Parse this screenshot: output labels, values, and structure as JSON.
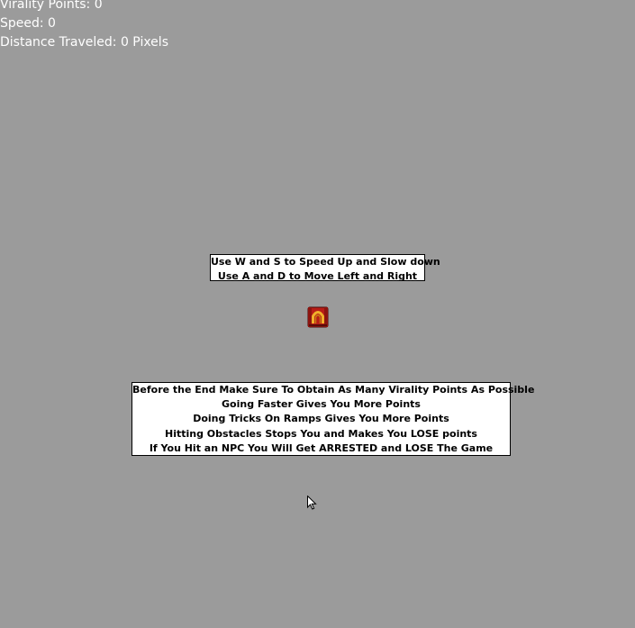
{
  "hud": {
    "virality": "Virality Points: 0",
    "speed": "Speed: 0",
    "distance": "Distance Traveled: 0 Pixels"
  },
  "controls": [
    "Use W and S to Speed Up and Slow down",
    "Use A and D to Move Left and Right"
  ],
  "rules": [
    "Before the End Make Sure To Obtain As Many Virality Points As Possible",
    "Going Faster Gives You More Points",
    "Doing Tricks On Ramps Gives You More Points",
    "Hitting Obstacles Stops You and Makes You LOSE points",
    "If You Hit an NPC You Will Get ARRESTED and LOSE The Game"
  ],
  "colors": {
    "background": "#9b9b9b",
    "hud_text": "#ffffff",
    "player_red": "#c0201a",
    "player_gold": "#e8a31c"
  },
  "icons": {
    "player": "red-skateboarder-sprite",
    "cursor": "mouse-pointer-icon"
  }
}
